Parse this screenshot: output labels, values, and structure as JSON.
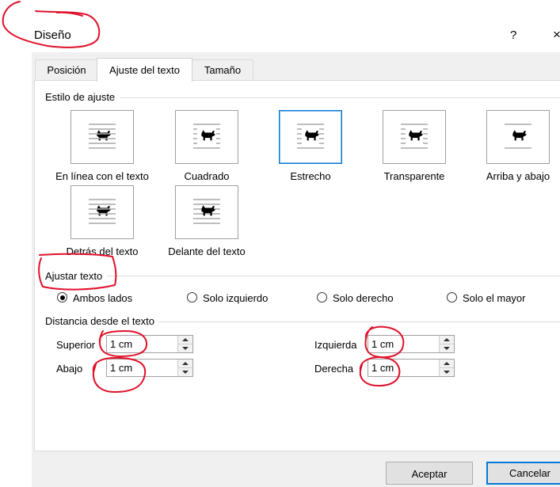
{
  "dialog": {
    "title": "Diseño",
    "help_label": "?",
    "close_label": "×"
  },
  "tabs": [
    {
      "label": "Posición",
      "active": false
    },
    {
      "label": "Ajuste del texto",
      "active": true
    },
    {
      "label": "Tamaño",
      "active": false
    }
  ],
  "wrap_style": {
    "title": "Estilo de ajuste",
    "options": [
      {
        "label": "En línea con el texto",
        "selected": false
      },
      {
        "label": "Cuadrado",
        "selected": false
      },
      {
        "label": "Estrecho",
        "selected": true
      },
      {
        "label": "Transparente",
        "selected": false
      },
      {
        "label": "Arriba y abajo",
        "selected": false
      },
      {
        "label": "Detrás del texto",
        "selected": false
      },
      {
        "label": "Delante del texto",
        "selected": false
      }
    ]
  },
  "wrap_text": {
    "title": "Ajustar texto",
    "options": [
      {
        "label": "Ambos lados",
        "selected": true
      },
      {
        "label": "Solo izquierdo",
        "selected": false
      },
      {
        "label": "Solo derecho",
        "selected": false
      },
      {
        "label": "Solo el mayor",
        "selected": false
      }
    ]
  },
  "distance": {
    "title": "Distancia desde el texto",
    "superior": {
      "label": "Superior",
      "value": "1 cm"
    },
    "abajo": {
      "label": "Abajo",
      "value": "1 cm"
    },
    "izquierda": {
      "label": "Izquierda",
      "value": "1 cm"
    },
    "derecha": {
      "label": "Derecha",
      "value": "1 cm"
    }
  },
  "buttons": {
    "ok": "Aceptar",
    "cancel": "Cancelar"
  },
  "colors": {
    "selection_border": "#0078d7",
    "annotation": "#e0102a",
    "background": "#f0f0f0"
  }
}
